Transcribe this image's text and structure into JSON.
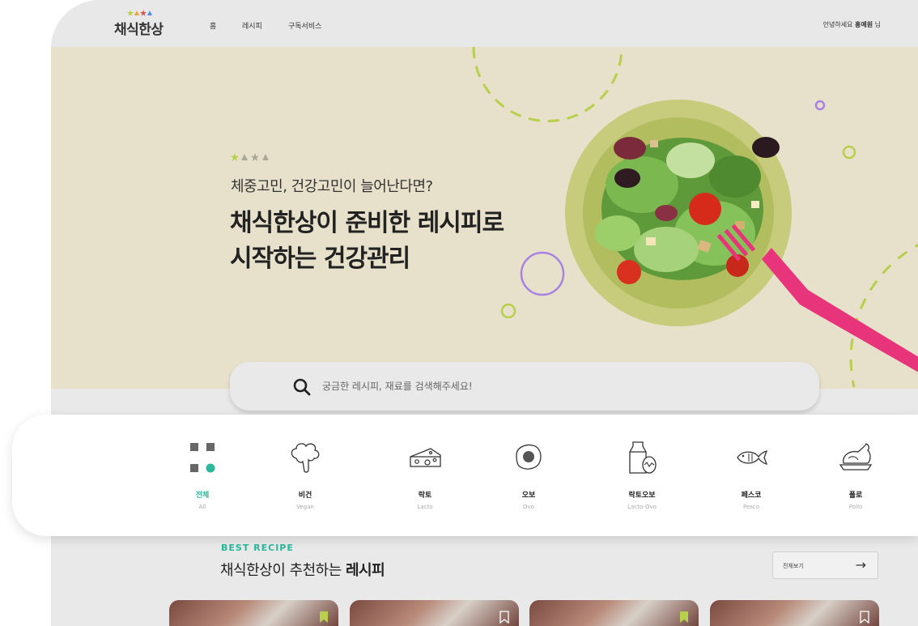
{
  "header": {
    "logo_text": "채식한상",
    "nav": [
      "홈",
      "레시피",
      "구독서비스"
    ],
    "greeting_prefix": "안녕하세요 ",
    "user_name": "홍예원",
    "greeting_suffix": " 님"
  },
  "hero": {
    "subtitle": "체중고민, 건강고민이 늘어난다면?",
    "title_line1": "채식한상이 준비한 레시피로",
    "title_line2": "시작하는 건강관리"
  },
  "search": {
    "placeholder": "궁금한 레시피, 재료를 검색해주세요!"
  },
  "categories": [
    {
      "name": "전체",
      "en": "All",
      "icon": "grid-icon",
      "active": true
    },
    {
      "name": "비건",
      "en": "Vegan",
      "icon": "broccoli-icon",
      "active": false
    },
    {
      "name": "락토",
      "en": "Lacto",
      "icon": "cheese-icon",
      "active": false
    },
    {
      "name": "오보",
      "en": "Ovo",
      "icon": "egg-icon",
      "active": false
    },
    {
      "name": "락토오보",
      "en": "Lacto-Ovo",
      "icon": "milk-egg-icon",
      "active": false
    },
    {
      "name": "페스코",
      "en": "Pesco",
      "icon": "fish-icon",
      "active": false
    },
    {
      "name": "폴로",
      "en": "Pollo",
      "icon": "chicken-icon",
      "active": false
    }
  ],
  "best": {
    "label": "BEST RECIPE",
    "title_prefix": "채식한상이 추천하는 ",
    "title_bold": "레시피",
    "view_all": "전체보기",
    "view_all_arrow": "→",
    "cards": [
      {
        "bookmarked": true
      },
      {
        "bookmarked": false
      },
      {
        "bookmarked": true
      },
      {
        "bookmarked": false
      }
    ]
  },
  "colors": {
    "accent": "#2bb89a",
    "hero_bg": "#e7e1cb",
    "lime": "#b7cf4a",
    "purple": "#a983e0",
    "fork_pink": "#e8347a"
  }
}
